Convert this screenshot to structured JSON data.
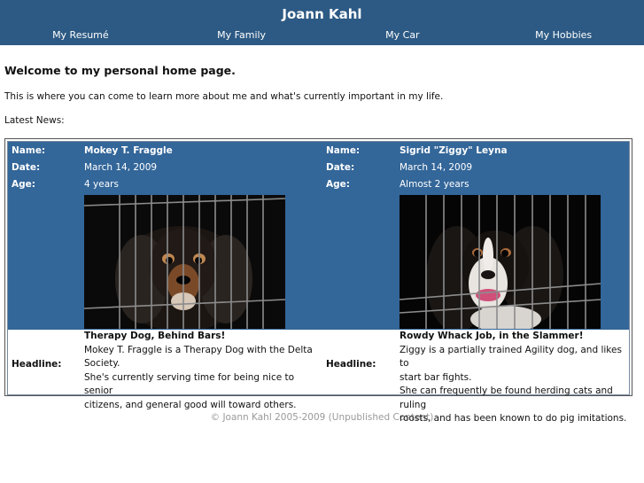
{
  "site": {
    "title": "Joann Kahl"
  },
  "nav": [
    {
      "label": "My Resumé"
    },
    {
      "label": "My Family"
    },
    {
      "label": "My Car"
    },
    {
      "label": "My Hobbies"
    }
  ],
  "content": {
    "welcome": "Welcome to my personal home page.",
    "intro": "This is where you can come to learn more about me and what's currently important in my life.",
    "latest_news": "Latest News:"
  },
  "labels": {
    "name": "Name:",
    "date": "Date:",
    "age": "Age:",
    "headline": "Headline:"
  },
  "dogs": [
    {
      "name": "Mokey T. Fraggle",
      "date": "March 14, 2009",
      "age": "4 years",
      "headline_title": "Therapy Dog, Behind Bars!",
      "headline_lines": [
        "Mokey T. Fraggle is a Therapy Dog with the Delta",
        "Society.",
        "She's currently serving time for being nice to senior",
        "citizens, and general good will toward others."
      ]
    },
    {
      "name": "Sigrid \"Ziggy\" Leyna",
      "date": "March 14, 2009",
      "age": "Almost 2 years",
      "headline_title": "Rowdy Whack Job, in the Slammer!",
      "headline_lines": [
        "Ziggy is a partially trained Agility dog, and likes to",
        "start bar fights.",
        "She can frequently be found herding cats and ruling",
        "roosts, and has been known to do pig imitations."
      ]
    }
  ],
  "footer": {
    "text": "© Joann Kahl 2005-2009 (Unpublished Content)"
  },
  "colors": {
    "header_bg": "#2d5a84",
    "panel_bg": "#336699"
  }
}
